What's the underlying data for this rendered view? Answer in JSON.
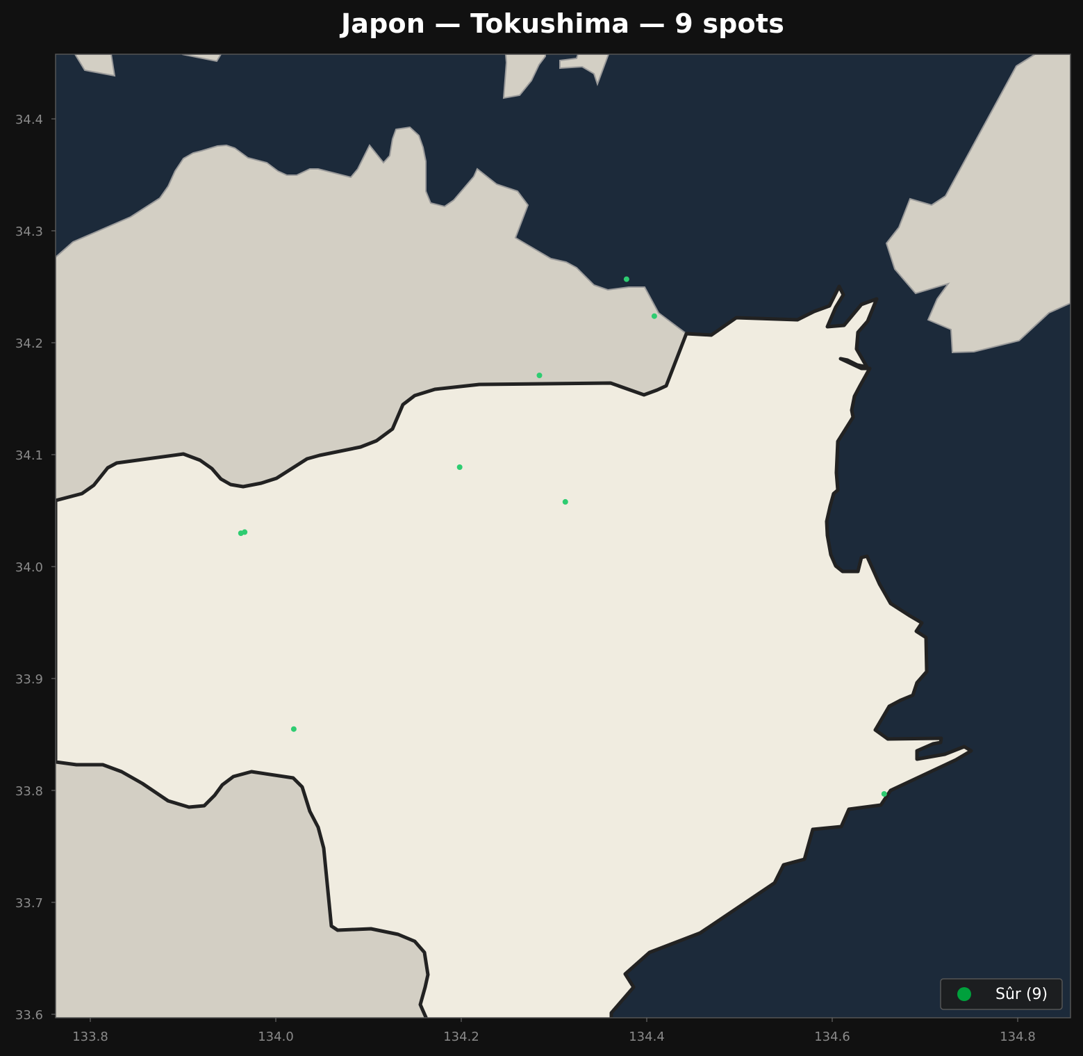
{
  "map": {
    "title": "Japon — Tokushima — 9 spots",
    "x_ticks": [
      "133.8",
      "134.0",
      "134.2",
      "134.4",
      "134.6",
      "134.8"
    ],
    "y_ticks": [
      "34.4",
      "34.3",
      "34.2",
      "34.1",
      "34.0",
      "33.9",
      "33.8",
      "33.7",
      "33.6"
    ],
    "x_range": [
      133.762,
      134.857
    ],
    "y_range": [
      33.597,
      34.458
    ],
    "colors": {
      "background": "#111111",
      "sea": "#1c2a3a",
      "other_land": "#d3cfc4",
      "region_land": "#f0ece0",
      "border": "#222222",
      "spot": "#2ecc71"
    },
    "legend": {
      "label": "Sûr (9)",
      "placement": "lower-right",
      "marker_color": "#00a03c"
    },
    "spots": [
      {
        "lon": 134.378,
        "lat": 34.257
      },
      {
        "lon": 134.408,
        "lat": 34.224
      },
      {
        "lon": 134.284,
        "lat": 34.171
      },
      {
        "lon": 134.198,
        "lat": 34.089
      },
      {
        "lon": 134.312,
        "lat": 34.058
      },
      {
        "lon": 133.962,
        "lat": 34.03
      },
      {
        "lon": 133.966,
        "lat": 34.031
      },
      {
        "lon": 134.019,
        "lat": 33.855
      },
      {
        "lon": 134.656,
        "lat": 33.797
      }
    ]
  }
}
